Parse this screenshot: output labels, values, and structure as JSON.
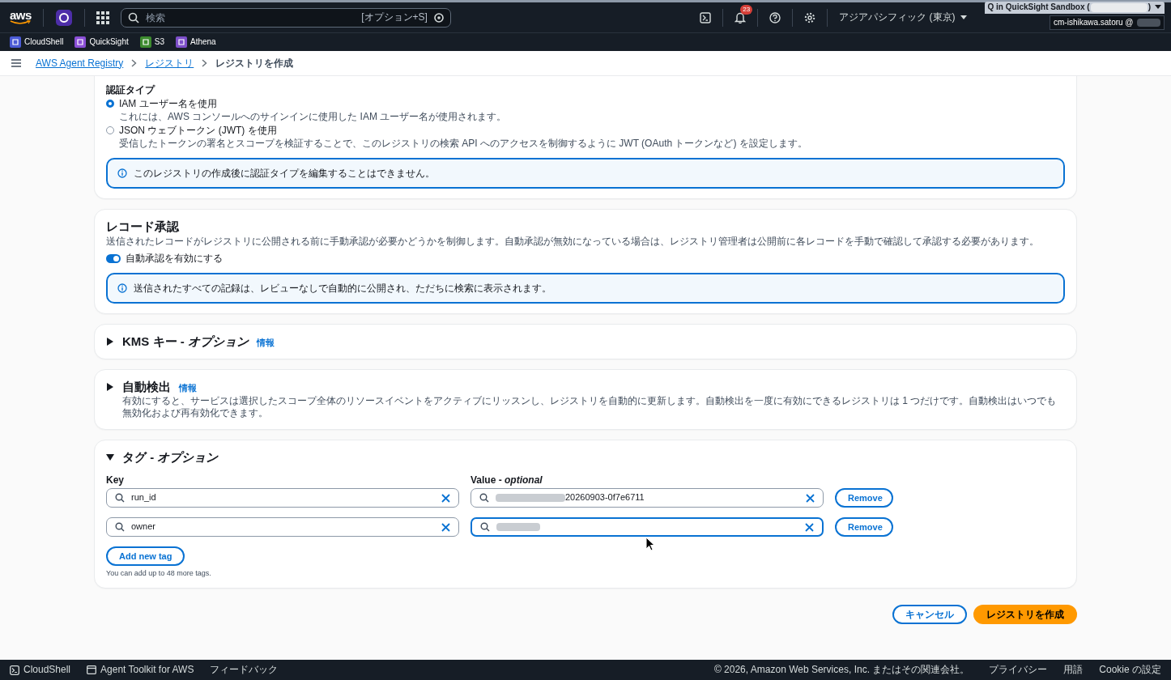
{
  "top_nav": {
    "logo": "aws",
    "search_placeholder": "検索",
    "search_shortcut": "[オプション+S]",
    "notification_count": "23",
    "region": "アジアパシフィック (東京)",
    "account_prefix": "Q in QuickSight Sandbox (",
    "account_suffix": ")",
    "user": "cm-ishikawa.satoru @"
  },
  "favorites": [
    {
      "label": "CloudShell",
      "color": "#4b5bd6"
    },
    {
      "label": "QuickSight",
      "color": "#8a4fd6"
    },
    {
      "label": "S3",
      "color": "#3d8b2f"
    },
    {
      "label": "Athena",
      "color": "#7d4fc9"
    }
  ],
  "breadcrumbs": [
    {
      "label": "AWS Agent Registry",
      "kind": "link"
    },
    {
      "label": "レジストリ",
      "kind": "link"
    },
    {
      "label": "レジストリを作成",
      "kind": "current"
    }
  ],
  "auth": {
    "label": "認証タイプ",
    "options": [
      {
        "label": "IAM ユーザー名を使用",
        "description": "これには、AWS コンソールへのサインインに使用した IAM ユーザー名が使用されます。",
        "selected": true
      },
      {
        "label": "JSON ウェブトークン (JWT) を使用",
        "description": "受信したトークンの署名とスコープを検証することで、このレジストリの検索 API へのアクセスを制御するように JWT (OAuth トークンなど) を設定します。",
        "selected": false
      }
    ],
    "alert": "このレジストリの作成後に認証タイプを編集することはできません。"
  },
  "approval": {
    "title": "レコード承認",
    "description": "送信されたレコードがレジストリに公開される前に手動承認が必要かどうかを制御します。自動承認が無効になっている場合は、レジストリ管理者は公開前に各レコードを手動で確認して承認する必要があります。",
    "toggle": {
      "label": "自動承認を有効にする",
      "on": true
    },
    "alert": "送信されたすべての記録は、レビューなしで自動的に公開され、ただちに検索に表示されます。"
  },
  "sections": [
    {
      "title": "KMS キー - *オプション*",
      "info": "情報",
      "expanded": false
    },
    {
      "title": "自動検出",
      "info": "情報",
      "expanded": false,
      "description": "有効にすると、サービスは選択したスコープ全体のリソースイベントをアクティブにリッスンし、レジストリを自動的に更新します。自動検出を一度に有効にできるレジストリは 1 つだけです。自動検出はいつでも無効化および再有効化できます。"
    }
  ],
  "tags": {
    "title": "タグ - *オプション*",
    "expanded": true,
    "key_label": "Key",
    "value_label": "Value - *optional*",
    "rows": [
      {
        "key": "run_id",
        "value": "20260903-0f7e6711",
        "redacted": true,
        "focused": false,
        "remove": "Remove"
      },
      {
        "key": "owner",
        "redacted": true,
        "focused": true,
        "remove": "Remove"
      }
    ],
    "add_button": "Add new tag",
    "hint": "You can add up to 48 more tags."
  },
  "actions": [
    {
      "label": "キャンセル",
      "kind": "normal"
    },
    {
      "label": "レジストリを作成",
      "kind": "primary"
    }
  ],
  "footer": {
    "left": [
      {
        "label": "CloudShell",
        "kind": "terminal"
      },
      {
        "label": "Agent Toolkit for AWS",
        "kind": "window"
      },
      {
        "label": "フィードバック",
        "kind": "plain"
      }
    ],
    "copyright": "© 2026, Amazon Web Services, Inc. またはその関連会社。",
    "links": [
      "プライバシー",
      "用語",
      "Cookie の設定"
    ]
  }
}
